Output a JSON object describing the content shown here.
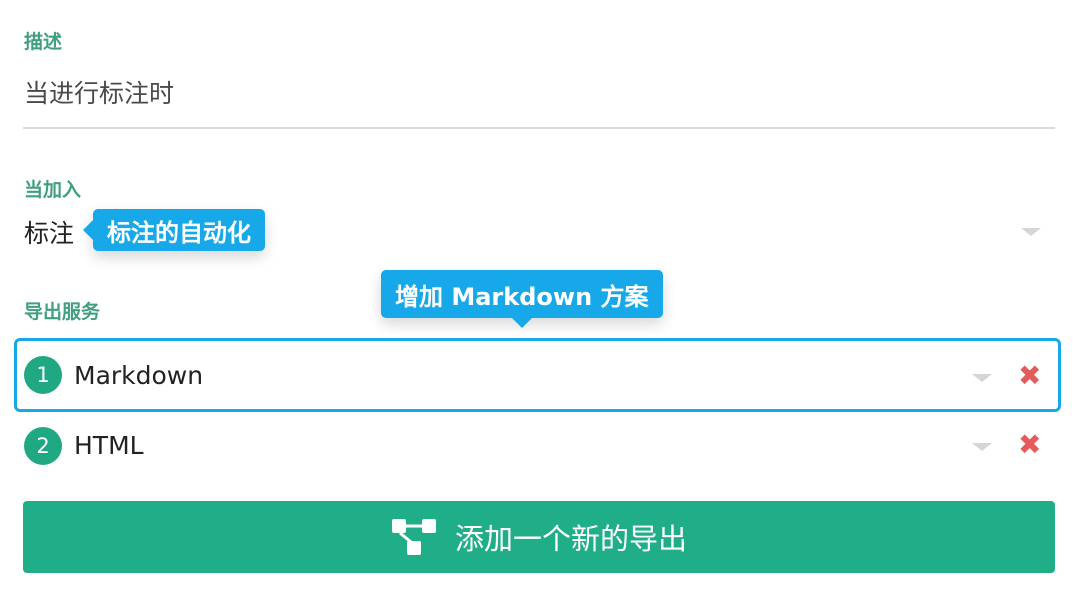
{
  "description": {
    "label": "描述",
    "value": "当进行标注时"
  },
  "trigger": {
    "label": "当加入",
    "value": "标注",
    "tooltip": "标注的自动化"
  },
  "services": {
    "label": "导出服务",
    "tooltip": "增加 Markdown 方案",
    "items": [
      {
        "index": "1",
        "name": "Markdown"
      },
      {
        "index": "2",
        "name": "HTML"
      }
    ],
    "remove_glyph": "✖"
  },
  "add_button": {
    "label": "添加一个新的导出",
    "icon": "flow-diagram-icon"
  },
  "colors": {
    "accent_green": "#1fae88",
    "label_green": "#3f9f80",
    "tooltip_blue": "#16a8e8",
    "remove_red": "#e55a5a"
  }
}
